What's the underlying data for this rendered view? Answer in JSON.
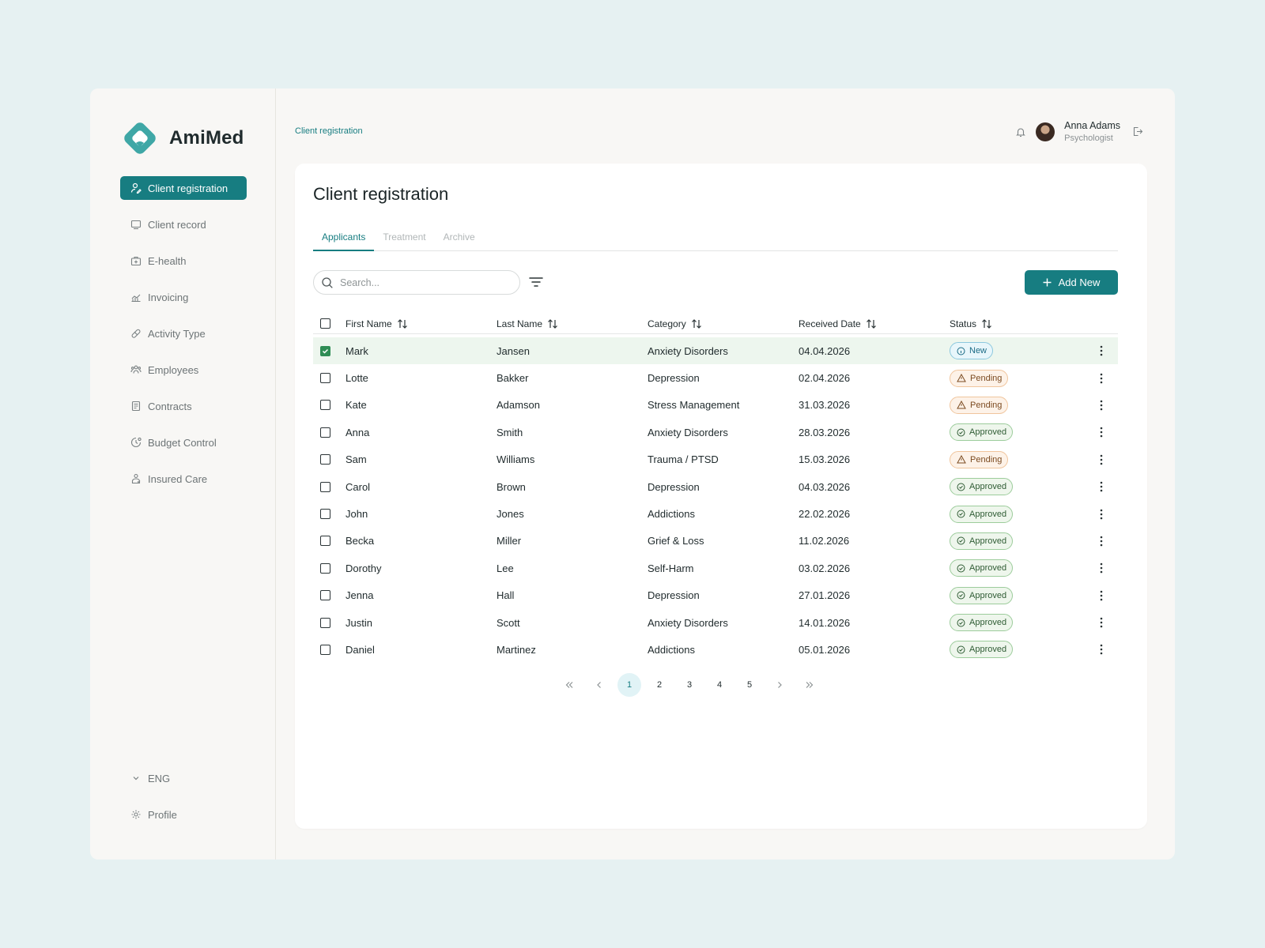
{
  "brand": {
    "name": "AmiMed",
    "logo_color": "#3fa7a6"
  },
  "sidebar": {
    "items": [
      {
        "label": "Client registration",
        "icon": "user-edit-icon",
        "active": true
      },
      {
        "label": "Client record",
        "icon": "record-icon",
        "active": false
      },
      {
        "label": "E-health",
        "icon": "medical-case-icon",
        "active": false
      },
      {
        "label": "Invoicing",
        "icon": "chart-icon",
        "active": false
      },
      {
        "label": "Activity Type",
        "icon": "pill-icon",
        "active": false
      },
      {
        "label": "Employees",
        "icon": "people-icon",
        "active": false
      },
      {
        "label": "Contracts",
        "icon": "document-icon",
        "active": false
      },
      {
        "label": "Budget Control",
        "icon": "clock-money-icon",
        "active": false
      },
      {
        "label": "Insured Care",
        "icon": "care-icon",
        "active": false
      }
    ],
    "language": "ENG",
    "profile": "Profile"
  },
  "header": {
    "breadcrumb": "Client registration",
    "user_name": "Anna Adams",
    "user_role": "Psychologist"
  },
  "main": {
    "title": "Client registration",
    "tabs": [
      {
        "label": "Applicants",
        "active": true
      },
      {
        "label": "Treatment",
        "active": false
      },
      {
        "label": "Archive",
        "active": false
      }
    ],
    "search_placeholder": "Search...",
    "add_label": "Add New",
    "columns": [
      "First Name",
      "Last Name",
      "Category",
      "Received Date",
      "Status"
    ],
    "rows": [
      {
        "first": "Mark",
        "last": "Jansen",
        "category": "Anxiety Disorders",
        "date": "04.04.2026",
        "status": "New",
        "checked": true
      },
      {
        "first": "Lotte",
        "last": "Bakker",
        "category": "Depression",
        "date": "02.04.2026",
        "status": "Pending",
        "checked": false
      },
      {
        "first": "Kate",
        "last": "Adamson",
        "category": "Stress Management",
        "date": "31.03.2026",
        "status": "Pending",
        "checked": false
      },
      {
        "first": "Anna",
        "last": "Smith",
        "category": "Anxiety Disorders",
        "date": "28.03.2026",
        "status": "Approved",
        "checked": false
      },
      {
        "first": "Sam",
        "last": "Williams",
        "category": "Trauma / PTSD",
        "date": "15.03.2026",
        "status": "Pending",
        "checked": false
      },
      {
        "first": "Carol",
        "last": "Brown",
        "category": "Depression",
        "date": "04.03.2026",
        "status": "Approved",
        "checked": false
      },
      {
        "first": "John",
        "last": "Jones",
        "category": "Addictions",
        "date": "22.02.2026",
        "status": "Approved",
        "checked": false
      },
      {
        "first": "Becka",
        "last": "Miller",
        "category": "Grief & Loss",
        "date": "11.02.2026",
        "status": "Approved",
        "checked": false
      },
      {
        "first": "Dorothy",
        "last": "Lee",
        "category": "Self-Harm",
        "date": "03.02.2026",
        "status": "Approved",
        "checked": false
      },
      {
        "first": "Jenna",
        "last": "Hall",
        "category": "Depression",
        "date": "27.01.2026",
        "status": "Approved",
        "checked": false
      },
      {
        "first": "Justin",
        "last": "Scott",
        "category": "Anxiety Disorders",
        "date": "14.01.2026",
        "status": "Approved",
        "checked": false
      },
      {
        "first": "Daniel",
        "last": "Martinez",
        "category": "Addictions",
        "date": "05.01.2026",
        "status": "Approved",
        "checked": false
      }
    ]
  },
  "pagination": {
    "pages": [
      "1",
      "2",
      "3",
      "4",
      "5"
    ],
    "current": "1"
  },
  "colors": {
    "accent": "#177d81",
    "new": "#1b6b85",
    "pending": "#7b4a20",
    "approved": "#2e5b33",
    "selected_row": "#edf6ee"
  }
}
